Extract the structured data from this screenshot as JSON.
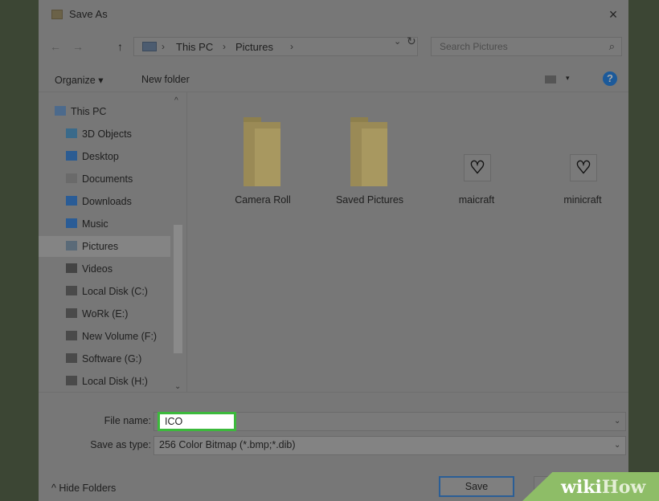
{
  "window": {
    "title": "Save As",
    "close_glyph": "×"
  },
  "address": {
    "back_glyph": "←",
    "forward_glyph": "→",
    "up_glyph": "↑",
    "crumbs": [
      "This PC",
      "Pictures"
    ],
    "separator": "›",
    "dropdown_glyph": "⌄",
    "refresh_glyph": "↻",
    "search_placeholder": "Search Pictures",
    "search_glyph": "⌕"
  },
  "toolbar": {
    "organize_label": "Organize ▾",
    "new_folder_label": "New folder",
    "view_caret": "▾",
    "help_glyph": "?"
  },
  "sidebar": {
    "items": [
      {
        "label": "This PC",
        "icon": "computer-icon",
        "color": "#4c6a8c"
      },
      {
        "label": "3D Objects",
        "icon": "cube-icon",
        "color": "#3a6a8a"
      },
      {
        "label": "Desktop",
        "icon": "desktop-icon",
        "color": "#2c5c92"
      },
      {
        "label": "Documents",
        "icon": "document-icon",
        "color": "#6a6a6a"
      },
      {
        "label": "Downloads",
        "icon": "download-arrow-icon",
        "color": "#2a5c96"
      },
      {
        "label": "Music",
        "icon": "music-note-icon",
        "color": "#2a5c96"
      },
      {
        "label": "Pictures",
        "icon": "picture-icon",
        "color": "#5a6a78"
      },
      {
        "label": "Videos",
        "icon": "video-icon",
        "color": "#444444"
      },
      {
        "label": "Local Disk (C:)",
        "icon": "drive-icon",
        "color": "#4a4a4a"
      },
      {
        "label": "WoRk (E:)",
        "icon": "drive-icon",
        "color": "#4a4a4a"
      },
      {
        "label": "New Volume (F:)",
        "icon": "drive-icon",
        "color": "#4a4a4a"
      },
      {
        "label": "Software (G:)",
        "icon": "drive-icon",
        "color": "#4a4a4a"
      },
      {
        "label": "Local Disk (H:)",
        "icon": "drive-icon",
        "color": "#4a4a4a"
      }
    ],
    "selected": "Pictures",
    "scroll_up_glyph": "^",
    "scroll_down_glyph": "⌄"
  },
  "content": {
    "items": [
      {
        "label": "Camera Roll",
        "type": "folder"
      },
      {
        "label": "Saved Pictures",
        "type": "folder"
      },
      {
        "label": "maicraft",
        "type": "file",
        "thumb": "♡"
      },
      {
        "label": "minicraft",
        "type": "file",
        "thumb": "♡"
      }
    ]
  },
  "footer": {
    "file_name_label": "File name:",
    "file_name_value": "ICO",
    "save_type_label": "Save as type:",
    "save_type_value": "256 Color Bitmap (*.bmp;*.dib)",
    "dropdown_glyph": "⌄",
    "hide_folders_label": "^ Hide Folders",
    "save_label": "Save"
  },
  "watermark": {
    "text_wiki": "wiki",
    "text_how": "How"
  },
  "colors": {
    "highlight": "#3cb93c",
    "accent": "#2a5e96",
    "watermark_bg": "#8ebd67"
  }
}
